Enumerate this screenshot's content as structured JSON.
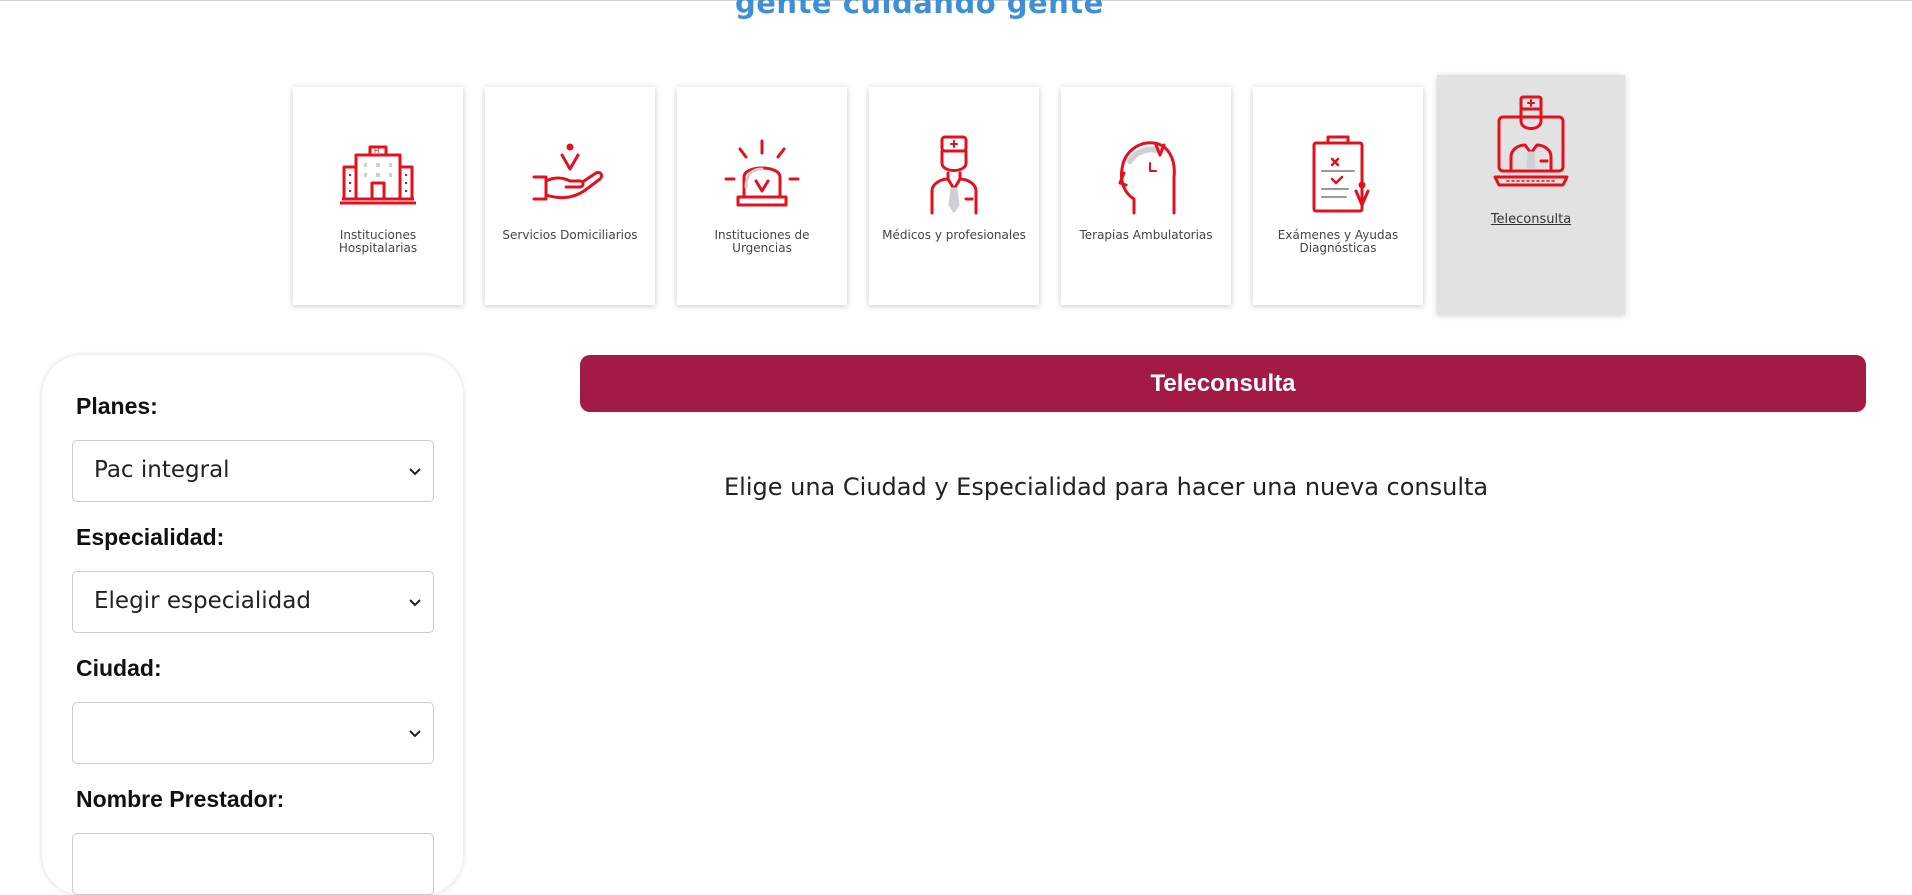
{
  "header": {
    "tagline": "gente cuidando gente"
  },
  "categories": [
    {
      "label": "Instituciones Hospitalarias",
      "icon": "hospital-icon"
    },
    {
      "label": "Servicios Domiciliarios",
      "icon": "home-care-hand-icon"
    },
    {
      "label": "Instituciones de Urgencias",
      "icon": "emergency-siren-icon"
    },
    {
      "label": "Médicos y profesionales",
      "icon": "doctor-icon"
    },
    {
      "label": "Terapias Ambulatorias",
      "icon": "therapy-head-icon"
    },
    {
      "label": "Exámenes y Ayudas Diagnósticas",
      "icon": "clipboard-exam-icon"
    },
    {
      "label": "Teleconsulta",
      "icon": "teleconsult-computer-icon",
      "active": true
    }
  ],
  "filters": {
    "planes_label": "Planes:",
    "planes_value": "Pac integral",
    "especialidad_label": "Especialidad:",
    "especialidad_value": "Elegir especialidad",
    "ciudad_label": "Ciudad:",
    "ciudad_value": "",
    "prestador_label": "Nombre Prestador:"
  },
  "main": {
    "banner_title": "Teleconsulta",
    "message": "Elige una Ciudad y Especialidad para hacer una nueva consulta"
  },
  "colors": {
    "accent": "#a31b45",
    "icon_red": "#e3101e",
    "tagline_blue": "#3f8fd6",
    "active_card_bg": "#e2e2e2"
  }
}
